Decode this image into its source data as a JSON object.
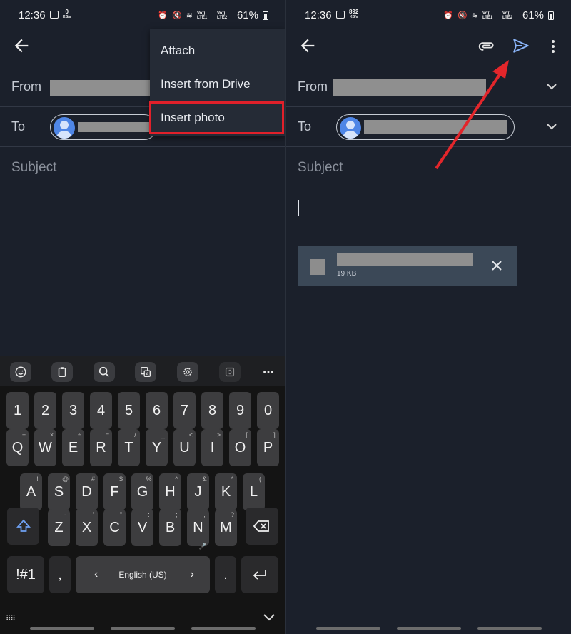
{
  "status_bar": {
    "time": "12:36",
    "left_speed_value": "0",
    "right_speed_value": "892",
    "speed_unit": "KB/s",
    "network_label": "Vo)) LTE1",
    "network_label_2": "Vo)) LTE2",
    "battery": "61%"
  },
  "compose": {
    "from_label": "From",
    "to_label": "To",
    "subject_placeholder": "Subject"
  },
  "menu": {
    "items": [
      "Attach",
      "Insert from Drive",
      "Insert photo"
    ]
  },
  "attachment": {
    "size": "19 KB"
  },
  "keyboard": {
    "numbers": [
      "1",
      "2",
      "3",
      "4",
      "5",
      "6",
      "7",
      "8",
      "9",
      "0"
    ],
    "row1": [
      {
        "k": "Q",
        "s": "+"
      },
      {
        "k": "W",
        "s": "×"
      },
      {
        "k": "E",
        "s": "÷"
      },
      {
        "k": "R",
        "s": "="
      },
      {
        "k": "T",
        "s": "/"
      },
      {
        "k": "Y",
        "s": "_"
      },
      {
        "k": "U",
        "s": "<"
      },
      {
        "k": "I",
        "s": ">"
      },
      {
        "k": "O",
        "s": "["
      },
      {
        "k": "P",
        "s": "]"
      }
    ],
    "row2": [
      {
        "k": "A",
        "s": "!"
      },
      {
        "k": "S",
        "s": "@"
      },
      {
        "k": "D",
        "s": "#"
      },
      {
        "k": "F",
        "s": "$"
      },
      {
        "k": "G",
        "s": "%"
      },
      {
        "k": "H",
        "s": "^"
      },
      {
        "k": "J",
        "s": "&"
      },
      {
        "k": "K",
        "s": "*"
      },
      {
        "k": "L",
        "s": "("
      }
    ],
    "row3": [
      {
        "k": "Z",
        "s": "-"
      },
      {
        "k": "X",
        "s": "'"
      },
      {
        "k": "C",
        "s": "\""
      },
      {
        "k": "V",
        "s": ":"
      },
      {
        "k": "B",
        "s": ";"
      },
      {
        "k": "N",
        "s": ","
      },
      {
        "k": "M",
        "s": "?"
      }
    ],
    "symbols_key": "!#1",
    "comma_key": ",",
    "period_key": ".",
    "language": "English (US)"
  },
  "colors": {
    "background": "#1b202b",
    "highlight_box": "#e0202a",
    "arrow": "#e3262b",
    "send_icon": "#8ab4f8"
  }
}
